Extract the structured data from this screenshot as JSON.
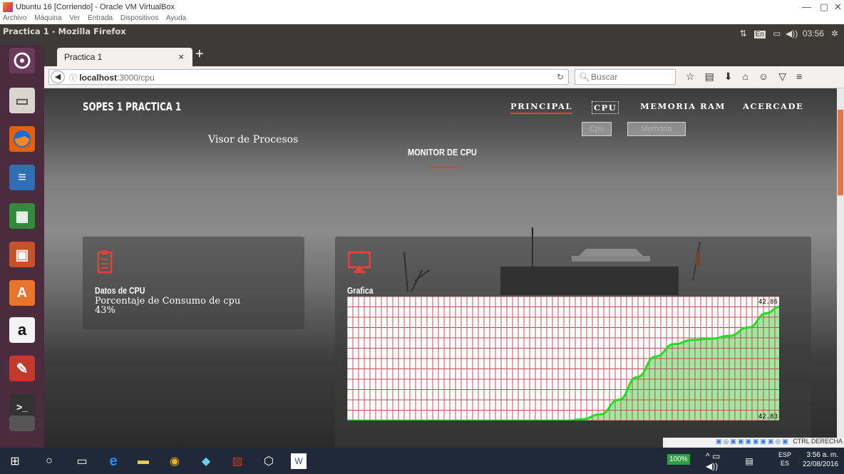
{
  "vbox": {
    "title": "Ubuntu 16 [Corriendo] - Oracle VM VirtualBox",
    "menu": [
      "Archivo",
      "Máquina",
      "Ver",
      "Entrada",
      "Dispositivos",
      "Ayuda"
    ],
    "tray_text": "CTRL DERECHA"
  },
  "ubuntu": {
    "window_title": "Practica 1 - Mozilla Firefox",
    "keyboard": "En",
    "time": "03:56"
  },
  "firefox": {
    "tab_title": "Practica 1",
    "url_host": "localhost",
    "url_path": ":3000/cpu",
    "search_placeholder": "Buscar"
  },
  "page": {
    "brand": "SOPES 1 PRACTICA 1",
    "nav": [
      "PRINCIPAL",
      "CPU",
      "MEMORIA RAM",
      "ACERCADE"
    ],
    "sub_buttons": [
      "Cpu",
      "Memoria"
    ],
    "visor": "Visor de Procesos",
    "section_title": "MONITOR DE CPU",
    "card1": {
      "title": "Datos de CPU",
      "label": "Porcentaje de Consumo de cpu",
      "value": "43%"
    },
    "card2": {
      "title": "Grafica"
    }
  },
  "chart_data": {
    "type": "area",
    "ylim": [
      42.83,
      42.86
    ],
    "y_labels": [
      "42.86",
      "42.83"
    ],
    "grid": true,
    "colors": {
      "grid": "#c0505a",
      "fill": "#9fe89f",
      "line": "#22dd22",
      "bg": "#ffffff"
    },
    "x": [
      0,
      1,
      2,
      3,
      4,
      5,
      6,
      7,
      8,
      9,
      10,
      11,
      12,
      13,
      14,
      15,
      16,
      17,
      18,
      19,
      20,
      21,
      22,
      23,
      24,
      25,
      26,
      27,
      28,
      29,
      30,
      31,
      32,
      33,
      34,
      35,
      36,
      37,
      38,
      39,
      40,
      41,
      42,
      43,
      44,
      45,
      46,
      47,
      48,
      49,
      50,
      51,
      52,
      53,
      54,
      55,
      56,
      57,
      58,
      59,
      60,
      61,
      62,
      63,
      64,
      65,
      66,
      67,
      68,
      69,
      70,
      71,
      72,
      73,
      74,
      75,
      76,
      77,
      78,
      79,
      80,
      81,
      82,
      83,
      84,
      85,
      86,
      87,
      88,
      89,
      90,
      91,
      92,
      93,
      94,
      95,
      96,
      97,
      98,
      99,
      100
    ],
    "values": [
      null,
      null,
      null,
      null,
      null,
      null,
      null,
      null,
      null,
      null,
      null,
      null,
      null,
      null,
      null,
      null,
      null,
      null,
      null,
      null,
      null,
      null,
      null,
      null,
      null,
      null,
      null,
      null,
      null,
      null,
      null,
      null,
      null,
      null,
      null,
      null,
      null,
      null,
      null,
      null,
      null,
      null,
      null,
      null,
      null,
      null,
      null,
      null,
      null,
      null,
      null,
      null,
      null,
      null,
      null,
      null,
      null,
      null,
      null,
      null,
      null,
      null,
      null,
      null,
      null,
      null,
      null,
      null,
      null,
      null,
      null,
      null,
      null,
      null,
      null,
      null,
      null,
      null,
      null,
      null,
      null,
      null,
      null,
      null,
      null,
      null,
      null,
      null,
      null,
      null,
      null,
      null,
      null,
      null,
      null,
      null,
      null,
      null,
      null,
      null,
      null
    ],
    "curve": [
      [
        0,
        42.83
      ],
      [
        36,
        42.83
      ],
      [
        38,
        42.8303
      ],
      [
        41,
        42.8315
      ],
      [
        44,
        42.835
      ],
      [
        47,
        42.8405
      ],
      [
        50,
        42.8455
      ],
      [
        53,
        42.8485
      ],
      [
        56,
        42.8495
      ],
      [
        59,
        42.8498
      ],
      [
        62,
        42.8505
      ],
      [
        65,
        42.8525
      ],
      [
        68,
        42.856
      ],
      [
        70,
        42.8575
      ]
    ]
  },
  "taskbar": {
    "battery": "100%",
    "lang": "ESP",
    "lang2": "ES",
    "time": "3:56 a. m.",
    "date": "22/08/2016"
  }
}
